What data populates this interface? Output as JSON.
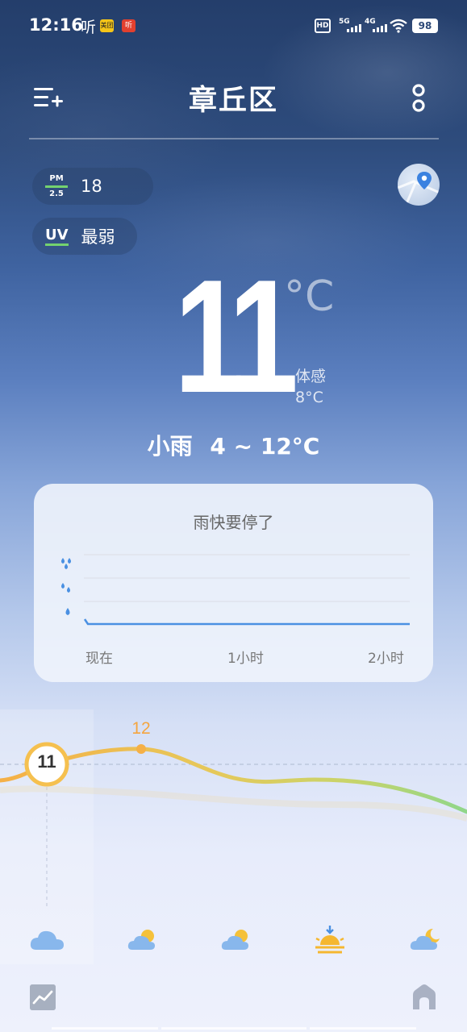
{
  "status_bar": {
    "time": "12:16",
    "app_icons": [
      "听",
      "美团",
      "听"
    ],
    "hd_label": "HD",
    "sim1": "5G",
    "sim2": "4G",
    "battery": "98"
  },
  "header": {
    "city": "章丘区",
    "left_icon": "menu-add-icon",
    "right_icon": "more-icon"
  },
  "air": {
    "pm_top": "PM",
    "pm_bottom": "2.5",
    "pm_value": "18",
    "uv_label": "UV",
    "uv_value": "最弱"
  },
  "current": {
    "temperature": "11",
    "unit": "°C",
    "feels_label": "体感",
    "feels_value": "8°C",
    "condition": "小雨",
    "range": "4 ~ 12°C"
  },
  "rain_card": {
    "title": "雨快要停了",
    "x_labels": [
      "现在",
      "1小时",
      "2小时"
    ]
  },
  "hourly": {
    "current_temp": "11",
    "peak_temp": "12",
    "icons": [
      "cloudy-icon",
      "partly-sunny-icon",
      "partly-sunny-icon",
      "sunset-icon",
      "partly-cloudy-night-icon"
    ]
  },
  "colors": {
    "accent_orange": "#f5b047",
    "curve_green": "#8fd68a",
    "rain_blue": "#4a90e2"
  }
}
